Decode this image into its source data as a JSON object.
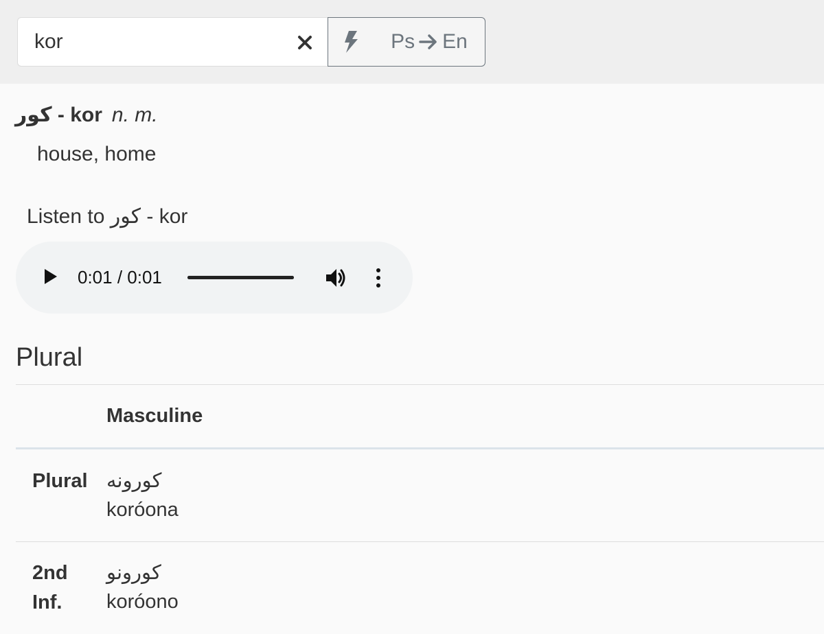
{
  "search": {
    "value": "kor",
    "clear_icon": "close-icon"
  },
  "toolbar": {
    "quick_icon": "lightning-icon",
    "lang_from": "Ps",
    "lang_to": "En",
    "arrow_icon": "arrow-right-icon"
  },
  "entry": {
    "ps": "کور",
    "separator": " - ",
    "word": "kor",
    "pos": "n. m.",
    "definition": "house, home"
  },
  "listen": {
    "prefix": "Listen to ",
    "ps": "کور",
    "separator": " - ",
    "word": "kor"
  },
  "player": {
    "time": "0:01 / 0:01",
    "progress": 1.0
  },
  "plural": {
    "title": "Plural",
    "column": "Masculine",
    "rows": [
      {
        "label": "Plural",
        "ps": "کورونه",
        "ph": "koróona"
      },
      {
        "label": "2nd Inf.",
        "ps": "کورونو",
        "ph": "koróono"
      }
    ]
  },
  "colors": {
    "accent": "#6c757d",
    "background": "#fafafa",
    "topbar": "#efefef"
  }
}
